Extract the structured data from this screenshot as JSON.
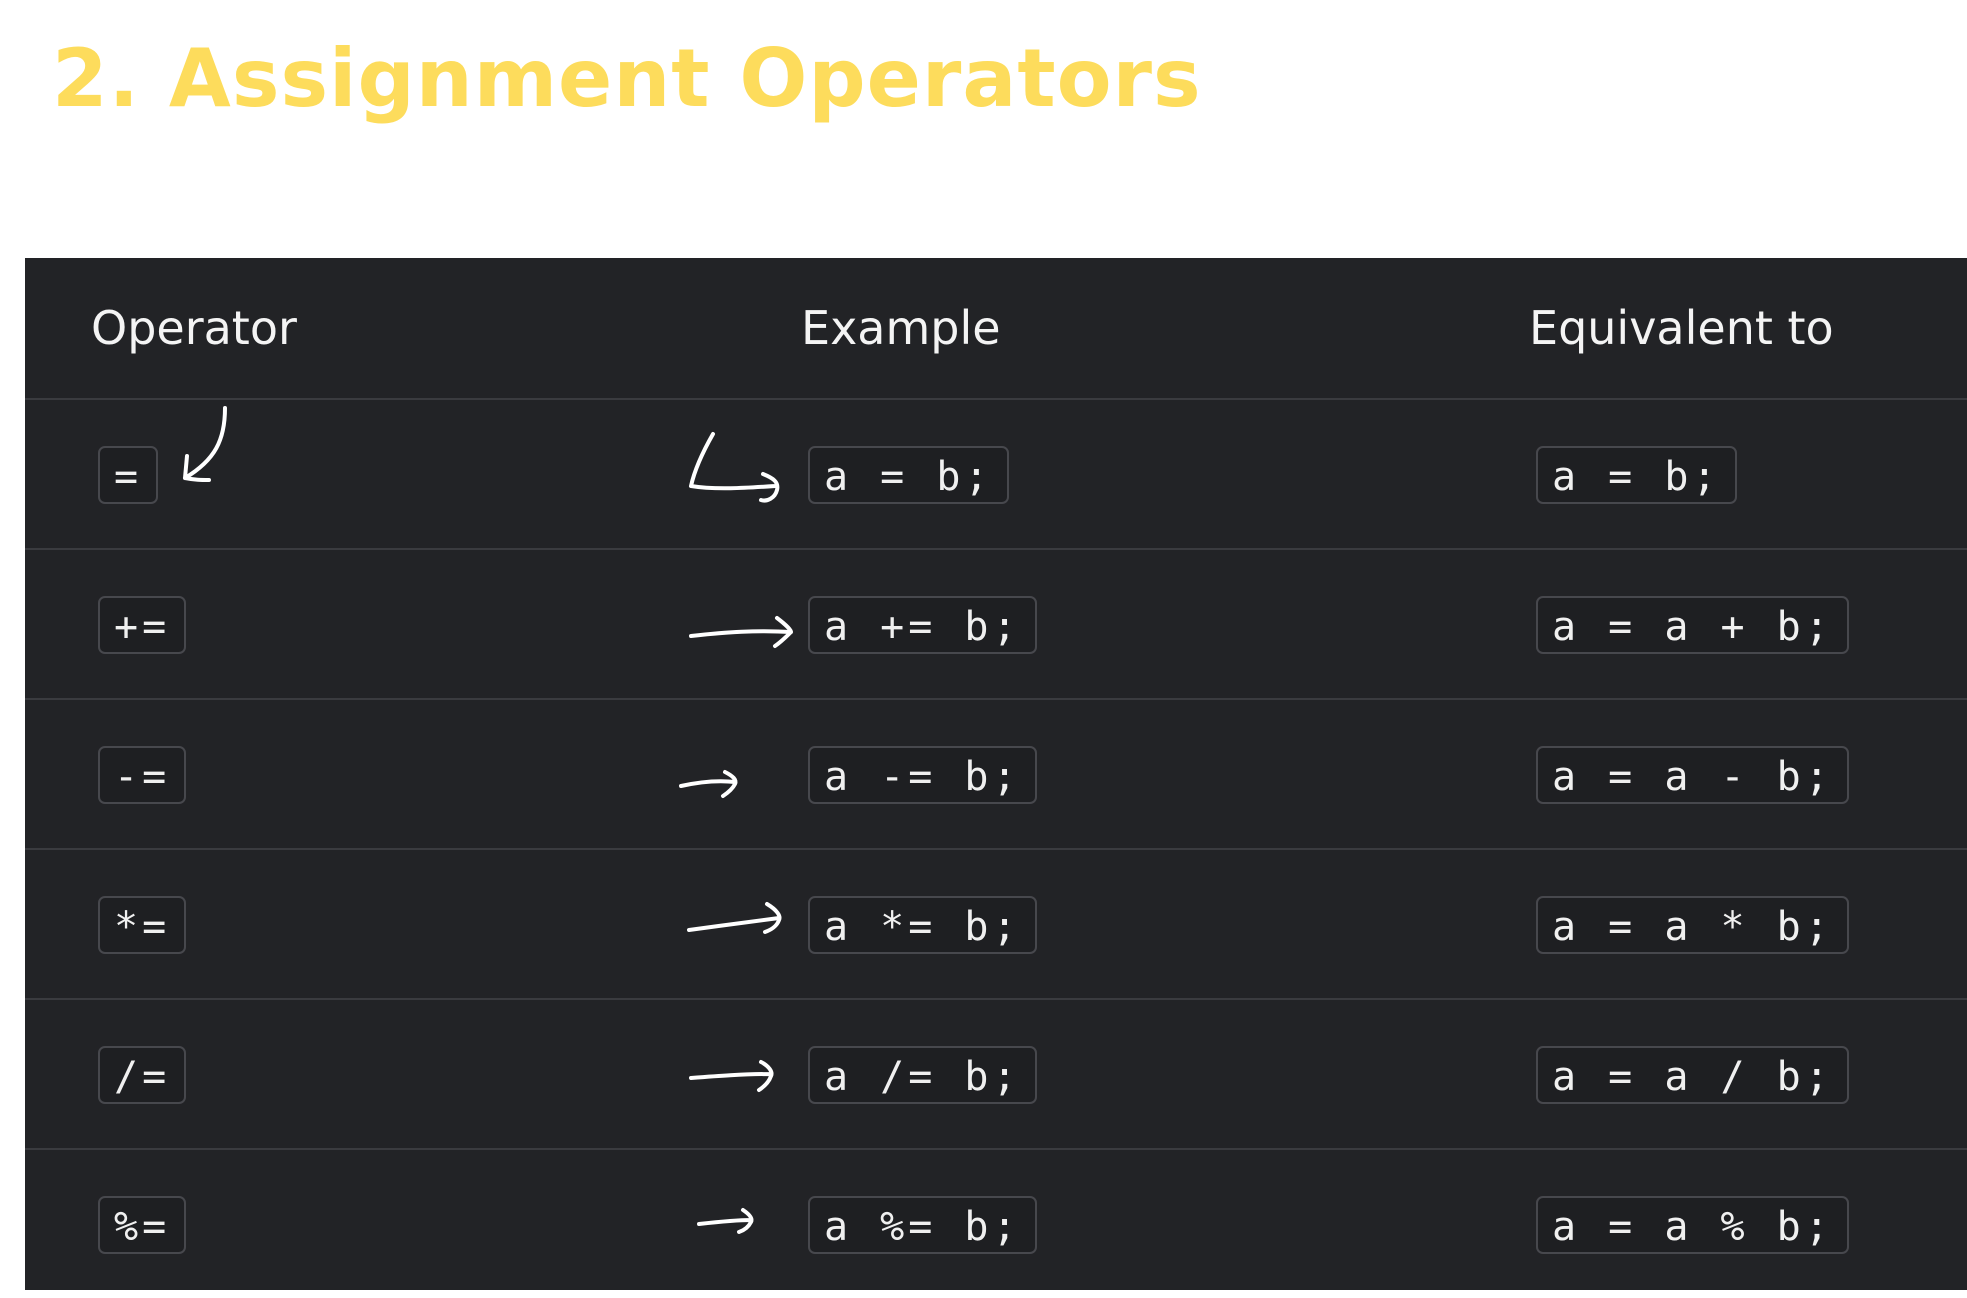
{
  "title": "2. Assignment Operators",
  "table": {
    "headers": {
      "operator": "Operator",
      "example": "Example",
      "equivalent": "Equivalent to"
    },
    "rows": [
      {
        "operator": "=",
        "example": "a = b;",
        "equivalent": "a = b;"
      },
      {
        "operator": "+=",
        "example": "a += b;",
        "equivalent": "a = a + b;"
      },
      {
        "operator": "-=",
        "example": "a -= b;",
        "equivalent": "a = a - b;"
      },
      {
        "operator": "*=",
        "example": "a *= b;",
        "equivalent": "a = a * b;"
      },
      {
        "operator": "/=",
        "example": "a /= b;",
        "equivalent": "a = a / b;"
      },
      {
        "operator": "%=",
        "example": "a %= b;",
        "equivalent": "a = a % b;"
      }
    ]
  },
  "colors": {
    "title": "#fddc5c",
    "table_background": "#222326",
    "row_separator": "#3a3b3f",
    "code_border": "#47484d",
    "text": "#f0f0f0"
  },
  "icons": [
    "hand-drawn-arrow-icon"
  ]
}
